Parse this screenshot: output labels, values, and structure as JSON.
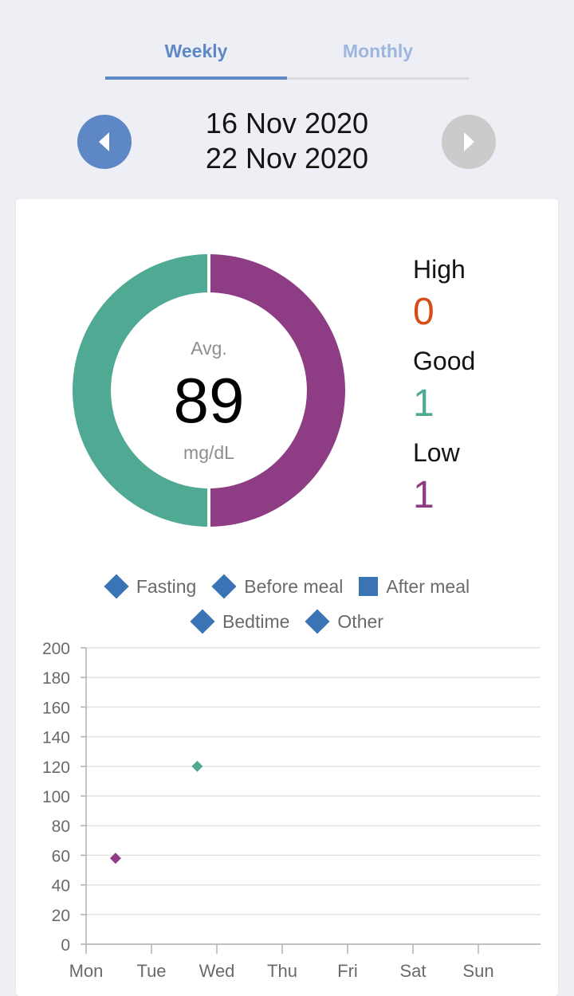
{
  "tabs": [
    {
      "label": "Weekly",
      "active": true
    },
    {
      "label": "Monthly",
      "active": false
    }
  ],
  "date_range": {
    "start": "16 Nov 2020",
    "end": "22 Nov 2020"
  },
  "summary": {
    "avg_label": "Avg.",
    "avg_value": "89",
    "unit": "mg/dL",
    "stats": [
      {
        "label": "High",
        "value": "0",
        "color": "#d64d1a"
      },
      {
        "label": "Good",
        "value": "1",
        "color": "#50a992"
      },
      {
        "label": "Low",
        "value": "1",
        "color": "#8e3c84"
      }
    ]
  },
  "legend": [
    {
      "label": "Fasting",
      "icon": "diamond-icon"
    },
    {
      "label": "Before meal",
      "icon": "diamond-icon"
    },
    {
      "label": "After meal",
      "icon": "square-icon"
    },
    {
      "label": "Bedtime",
      "icon": "diamond-icon"
    },
    {
      "label": "Other",
      "icon": "diamond-icon"
    }
  ],
  "chart_data": [
    {
      "type": "pie",
      "variant": "donut",
      "slices": [
        {
          "label": "Good",
          "value": 1,
          "color": "#50a992"
        },
        {
          "label": "Low",
          "value": 1,
          "color": "#8e3c84"
        },
        {
          "label": "High",
          "value": 0,
          "color": "#d64d1a"
        }
      ]
    },
    {
      "type": "scatter",
      "categories": [
        "Mon",
        "Tue",
        "Wed",
        "Thu",
        "Fri",
        "Sat",
        "Sun"
      ],
      "ylim": [
        0,
        200
      ],
      "yticks": [
        0,
        20,
        40,
        60,
        80,
        100,
        120,
        140,
        160,
        180,
        200
      ],
      "grid": true,
      "points": [
        {
          "x": 0.45,
          "y": 58,
          "color": "#8e3c84"
        },
        {
          "x": 1.7,
          "y": 120,
          "color": "#50a992"
        }
      ]
    }
  ]
}
